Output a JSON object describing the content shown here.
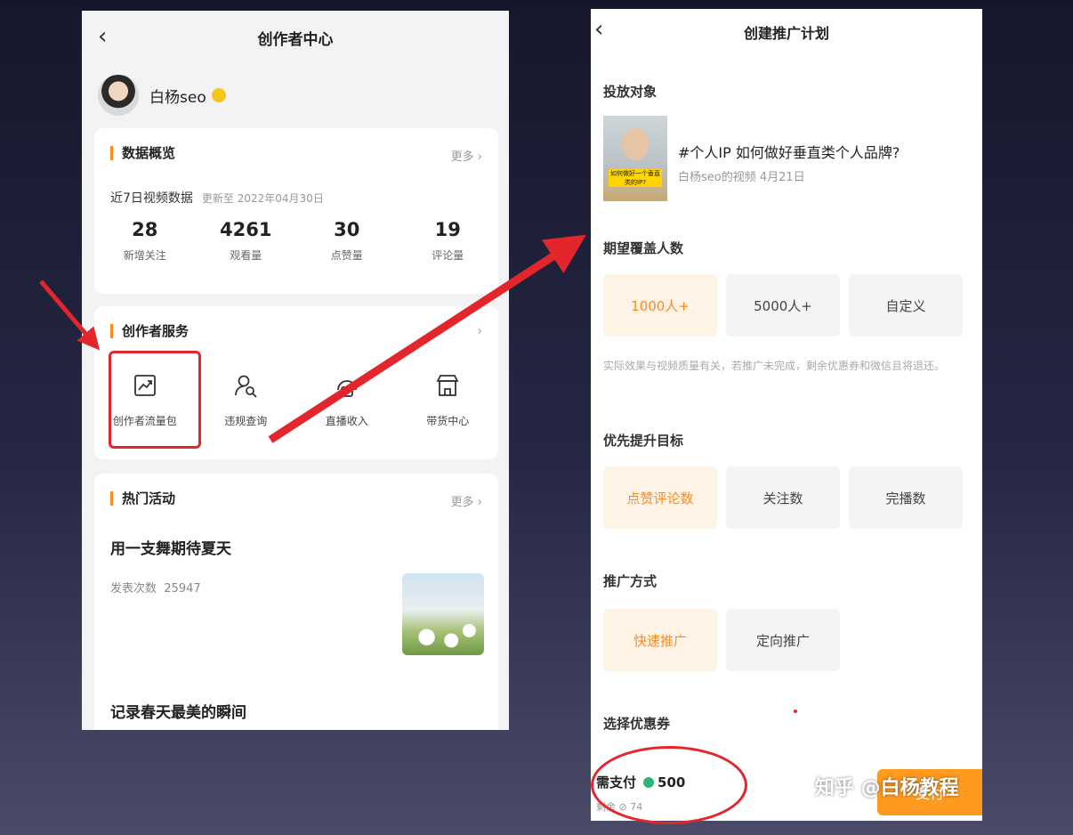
{
  "left": {
    "title": "创作者中心",
    "back_glyph": "‹",
    "profile": {
      "name": "白杨seo"
    },
    "data_card": {
      "title": "数据概览",
      "more": "更多 ›",
      "subtitle": "近7日视频数据",
      "updated": "更新至 2022年04月30日",
      "stats": [
        {
          "value": "28",
          "label": "新增关注"
        },
        {
          "value": "4261",
          "label": "观看量"
        },
        {
          "value": "30",
          "label": "点赞量"
        },
        {
          "value": "19",
          "label": "评论量"
        }
      ]
    },
    "service_card": {
      "title": "创作者服务",
      "more": "›",
      "items": [
        {
          "label": "创作者流量包",
          "icon": "trend-chart-icon"
        },
        {
          "label": "违规查询",
          "icon": "user-search-icon"
        },
        {
          "label": "直播收入",
          "icon": "live-income-icon"
        },
        {
          "label": "带货中心",
          "icon": "store-icon"
        }
      ]
    },
    "hot_card": {
      "title": "热门活动",
      "more": "更多 ›",
      "activities": [
        {
          "title": "用一支舞期待夏天",
          "count_label": "发表次数",
          "count": "25947"
        },
        {
          "title": "记录春天最美的瞬间"
        }
      ]
    }
  },
  "right": {
    "title": "创建推广计划",
    "back_glyph": "‹",
    "target": {
      "label": "投放对象",
      "video_title": "#个人IP 如何做好垂直类个人品牌?",
      "video_meta": "白杨seo的视频  4月21日",
      "thumb_text": "如何做好一个垂直类的IP?"
    },
    "coverage": {
      "label": "期望覆盖人数",
      "options": [
        "1000人+",
        "5000人+",
        "自定义"
      ],
      "selected": 0,
      "note": "实际效果与视频质量有关，若推广未完成，剩余优惠券和微信且将退还。"
    },
    "goal": {
      "label": "优先提升目标",
      "options": [
        "点赞评论数",
        "关注数",
        "完播数"
      ],
      "selected": 0
    },
    "method": {
      "label": "推广方式",
      "options": [
        "快速推广",
        "定向推广"
      ],
      "selected": 0
    },
    "coupon": {
      "label": "选择优惠券"
    },
    "pay": {
      "label": "需支付",
      "amount": "500",
      "remaining": "剩余 ⊘ 74",
      "button": "支付"
    }
  },
  "watermark": {
    "text": "知乎 @白杨教程"
  },
  "colors": {
    "accent": "#ff8a1f",
    "annotation": "#e2262c",
    "coin": "#2bb673"
  }
}
